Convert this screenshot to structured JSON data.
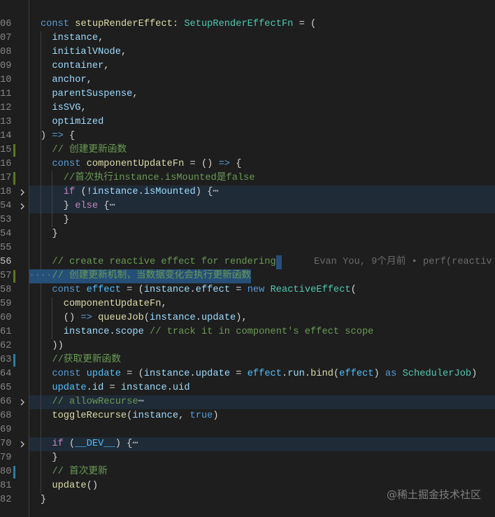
{
  "editor": {
    "theme": {
      "background": "#1e1e1e",
      "p": "#d4d4d4",
      "kw": "#569cd6",
      "ctl": "#c586c0",
      "var": "#9cdcfe",
      "const": "#4fc1ff",
      "fn": "#dcdcaa",
      "type": "#4ec9b0",
      "cmt": "#6a9955",
      "fold": "#c5c5c5",
      "ws": "#5b7a96",
      "line_number": "#858585",
      "line_number_active": "#c6c6c6",
      "selection": "#264f78",
      "folded_bg": "#1f2b37",
      "git_added": "#587c0c",
      "git_modified": "#1b81a8",
      "blame": "#6b6b6b",
      "indent_guide": "#404040",
      "chevron": "#c5c5c5"
    },
    "lines": [
      {
        "num": "",
        "tokens": [
          {
            "t": "  }"
          }
        ]
      },
      {
        "num": "",
        "tokens": []
      },
      {
        "num": "06",
        "tokens": [
          {
            "t": "  "
          },
          {
            "t": "const",
            "k": "kw"
          },
          {
            "t": " "
          },
          {
            "t": "setupRenderEffect",
            "k": "fn"
          },
          {
            "t": ": "
          },
          {
            "t": "SetupRenderEffectFn",
            "k": "type"
          },
          {
            "t": " = ("
          }
        ]
      },
      {
        "num": "07",
        "tokens": [
          {
            "t": "    "
          },
          {
            "t": "instance",
            "k": "var"
          },
          {
            "t": ","
          }
        ]
      },
      {
        "num": "08",
        "tokens": [
          {
            "t": "    "
          },
          {
            "t": "initialVNode",
            "k": "var"
          },
          {
            "t": ","
          }
        ]
      },
      {
        "num": "09",
        "tokens": [
          {
            "t": "    "
          },
          {
            "t": "container",
            "k": "var"
          },
          {
            "t": ","
          }
        ]
      },
      {
        "num": "10",
        "tokens": [
          {
            "t": "    "
          },
          {
            "t": "anchor",
            "k": "var"
          },
          {
            "t": ","
          }
        ]
      },
      {
        "num": "11",
        "tokens": [
          {
            "t": "    "
          },
          {
            "t": "parentSuspense",
            "k": "var"
          },
          {
            "t": ","
          }
        ]
      },
      {
        "num": "12",
        "tokens": [
          {
            "t": "    "
          },
          {
            "t": "isSVG",
            "k": "var"
          },
          {
            "t": ","
          }
        ]
      },
      {
        "num": "13",
        "tokens": [
          {
            "t": "    "
          },
          {
            "t": "optimized",
            "k": "var"
          }
        ]
      },
      {
        "num": "14",
        "tokens": [
          {
            "t": "  ) "
          },
          {
            "t": "=>",
            "k": "kw"
          },
          {
            "t": " {"
          }
        ]
      },
      {
        "num": "15",
        "git": "added",
        "tokens": [
          {
            "t": "    "
          },
          {
            "t": "// 创建更新函数",
            "k": "cmt"
          }
        ]
      },
      {
        "num": "16",
        "tokens": [
          {
            "t": "    "
          },
          {
            "t": "const",
            "k": "kw"
          },
          {
            "t": " "
          },
          {
            "t": "componentUpdateFn",
            "k": "fn"
          },
          {
            "t": " = () "
          },
          {
            "t": "=>",
            "k": "kw"
          },
          {
            "t": " {"
          }
        ]
      },
      {
        "num": "17",
        "git": "added",
        "tokens": [
          {
            "t": "      "
          },
          {
            "t": "//首次执行instance.isMounted是false",
            "k": "cmt"
          }
        ]
      },
      {
        "num": "18",
        "fold": true,
        "folded": true,
        "tokens": [
          {
            "t": "      "
          },
          {
            "t": "if",
            "k": "ctl"
          },
          {
            "t": " (!"
          },
          {
            "t": "instance",
            "k": "var"
          },
          {
            "t": "."
          },
          {
            "t": "isMounted",
            "k": "var"
          },
          {
            "t": ") {"
          },
          {
            "t": "⋯",
            "k": "fold"
          }
        ]
      },
      {
        "num": "54",
        "fold": true,
        "folded": true,
        "tokens": [
          {
            "t": "      } "
          },
          {
            "t": "else",
            "k": "ctl"
          },
          {
            "t": " {"
          },
          {
            "t": "⋯",
            "k": "fold"
          }
        ]
      },
      {
        "num": "53",
        "tokens": [
          {
            "t": "      }"
          }
        ]
      },
      {
        "num": "54",
        "tokens": [
          {
            "t": "    }"
          }
        ]
      },
      {
        "num": "55",
        "tokens": []
      },
      {
        "num": "56",
        "active": true,
        "sel_eol": true,
        "tokens": [
          {
            "t": "    "
          },
          {
            "t": "// create reactive effect for rendering",
            "k": "cmt"
          }
        ],
        "blame": "Evan You, 9个月前 • perf(reactiv"
      },
      {
        "num": "57",
        "git": "added",
        "selected": true,
        "tokens": [
          {
            "t": "····",
            "k": "ws"
          },
          {
            "t": "// 创建更新机制，当数据变化会执行更新函数",
            "k": "cmt"
          }
        ]
      },
      {
        "num": "58",
        "tokens": [
          {
            "t": "    "
          },
          {
            "t": "const",
            "k": "kw"
          },
          {
            "t": " "
          },
          {
            "t": "effect",
            "k": "const"
          },
          {
            "t": " = ("
          },
          {
            "t": "instance",
            "k": "var"
          },
          {
            "t": "."
          },
          {
            "t": "effect",
            "k": "var"
          },
          {
            "t": " = "
          },
          {
            "t": "new",
            "k": "kw"
          },
          {
            "t": " "
          },
          {
            "t": "ReactiveEffect",
            "k": "type"
          },
          {
            "t": "("
          }
        ]
      },
      {
        "num": "59",
        "tokens": [
          {
            "t": "      "
          },
          {
            "t": "componentUpdateFn",
            "k": "fn"
          },
          {
            "t": ","
          }
        ]
      },
      {
        "num": "60",
        "tokens": [
          {
            "t": "      () "
          },
          {
            "t": "=>",
            "k": "kw"
          },
          {
            "t": " "
          },
          {
            "t": "queueJob",
            "k": "fn"
          },
          {
            "t": "("
          },
          {
            "t": "instance",
            "k": "var"
          },
          {
            "t": "."
          },
          {
            "t": "update",
            "k": "var"
          },
          {
            "t": "),"
          }
        ]
      },
      {
        "num": "61",
        "tokens": [
          {
            "t": "      "
          },
          {
            "t": "instance",
            "k": "var"
          },
          {
            "t": "."
          },
          {
            "t": "scope",
            "k": "var"
          },
          {
            "t": " "
          },
          {
            "t": "// track it in component's effect scope",
            "k": "cmt"
          }
        ]
      },
      {
        "num": "62",
        "tokens": [
          {
            "t": "    ))"
          }
        ]
      },
      {
        "num": "63",
        "git": "modified",
        "tokens": [
          {
            "t": "    "
          },
          {
            "t": "//获取更新函数",
            "k": "cmt"
          }
        ]
      },
      {
        "num": "64",
        "tokens": [
          {
            "t": "    "
          },
          {
            "t": "const",
            "k": "kw"
          },
          {
            "t": " "
          },
          {
            "t": "update",
            "k": "const"
          },
          {
            "t": " = ("
          },
          {
            "t": "instance",
            "k": "var"
          },
          {
            "t": "."
          },
          {
            "t": "update",
            "k": "var"
          },
          {
            "t": " = "
          },
          {
            "t": "effect",
            "k": "const"
          },
          {
            "t": "."
          },
          {
            "t": "run",
            "k": "var"
          },
          {
            "t": "."
          },
          {
            "t": "bind",
            "k": "fn"
          },
          {
            "t": "("
          },
          {
            "t": "effect",
            "k": "const"
          },
          {
            "t": ") "
          },
          {
            "t": "as",
            "k": "kw"
          },
          {
            "t": " "
          },
          {
            "t": "SchedulerJob",
            "k": "type"
          },
          {
            "t": ")"
          }
        ]
      },
      {
        "num": "65",
        "tokens": [
          {
            "t": "    "
          },
          {
            "t": "update",
            "k": "const"
          },
          {
            "t": "."
          },
          {
            "t": "id",
            "k": "var"
          },
          {
            "t": " = "
          },
          {
            "t": "instance",
            "k": "var"
          },
          {
            "t": "."
          },
          {
            "t": "uid",
            "k": "var"
          }
        ]
      },
      {
        "num": "66",
        "fold": true,
        "folded": true,
        "tokens": [
          {
            "t": "    "
          },
          {
            "t": "// allowRecurse",
            "k": "cmt"
          },
          {
            "t": "⋯",
            "k": "fold"
          }
        ]
      },
      {
        "num": "68",
        "tokens": [
          {
            "t": "    "
          },
          {
            "t": "toggleRecurse",
            "k": "fn"
          },
          {
            "t": "("
          },
          {
            "t": "instance",
            "k": "var"
          },
          {
            "t": ", "
          },
          {
            "t": "true",
            "k": "kw"
          },
          {
            "t": ")"
          }
        ]
      },
      {
        "num": "69",
        "tokens": []
      },
      {
        "num": "70",
        "fold": true,
        "folded": true,
        "tokens": [
          {
            "t": "    "
          },
          {
            "t": "if",
            "k": "ctl"
          },
          {
            "t": " ("
          },
          {
            "t": "__DEV__",
            "k": "const"
          },
          {
            "t": ") {"
          },
          {
            "t": "⋯",
            "k": "fold"
          }
        ]
      },
      {
        "num": "79",
        "tokens": [
          {
            "t": "    }"
          }
        ]
      },
      {
        "num": "80",
        "git": "modified",
        "tokens": [
          {
            "t": "    "
          },
          {
            "t": "// 首次更新",
            "k": "cmt"
          }
        ]
      },
      {
        "num": "81",
        "tokens": [
          {
            "t": "    "
          },
          {
            "t": "update",
            "k": "fn"
          },
          {
            "t": "()"
          }
        ]
      },
      {
        "num": "82",
        "tokens": [
          {
            "t": "  }"
          }
        ]
      }
    ]
  },
  "watermark": "@稀土掘金技术社区"
}
